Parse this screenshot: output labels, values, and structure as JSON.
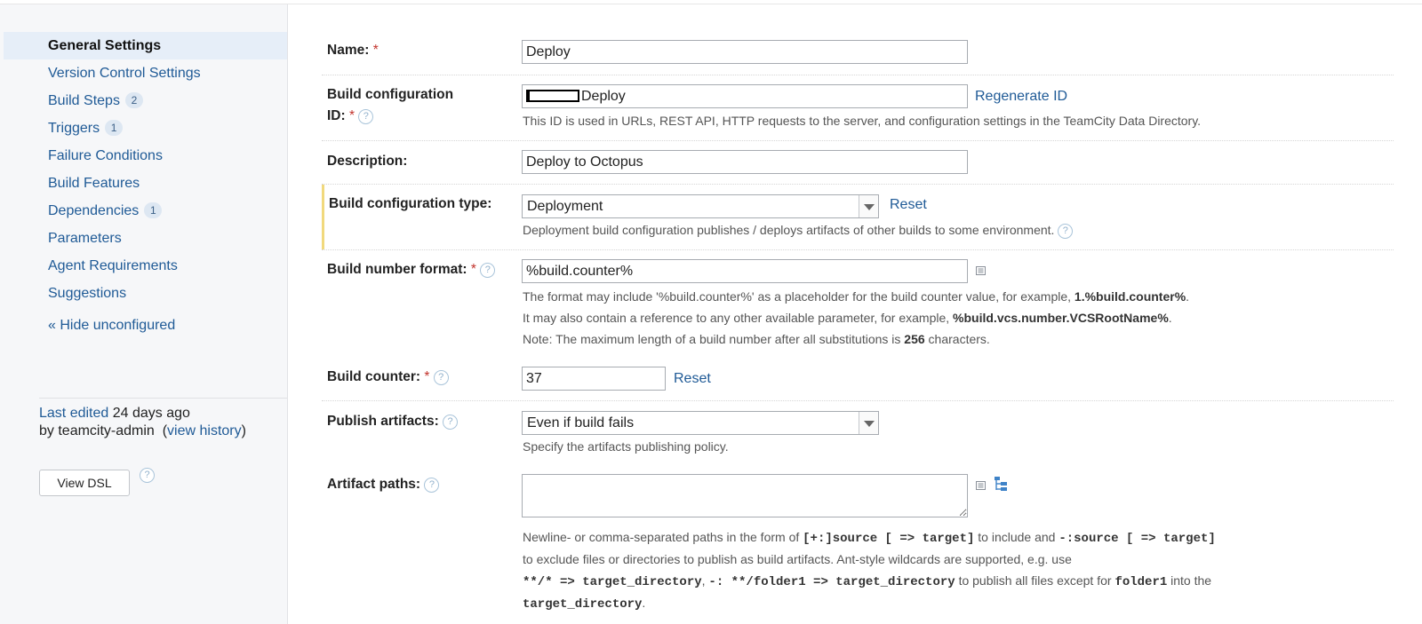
{
  "sidebar": {
    "items": [
      {
        "label": "General Settings"
      },
      {
        "label": "Version Control Settings"
      },
      {
        "label": "Build Steps",
        "badge": "2"
      },
      {
        "label": "Triggers",
        "badge": "1"
      },
      {
        "label": "Failure Conditions"
      },
      {
        "label": "Build Features"
      },
      {
        "label": "Dependencies",
        "badge": "1"
      },
      {
        "label": "Parameters"
      },
      {
        "label": "Agent Requirements"
      },
      {
        "label": "Suggestions"
      }
    ],
    "hide_unconfigured": "« Hide unconfigured",
    "last_edited_prefix": "Last edited",
    "last_edited_time": "24 days ago",
    "edited_by_prefix": "by teamcity-admin",
    "open_paren": "(",
    "view_history": "view history",
    "close_paren": ")",
    "view_dsl": "View DSL"
  },
  "form": {
    "name": {
      "label": "Name:",
      "required": "*",
      "value": "Deploy"
    },
    "build_id": {
      "label_line1": "Build configuration",
      "label_line2": "ID:",
      "required": "*",
      "value": "Deploy",
      "regenerate": "Regenerate ID",
      "note": "This ID is used in URLs, REST API, HTTP requests to the server, and configuration settings in the TeamCity Data Directory."
    },
    "description": {
      "label": "Description:",
      "value": "Deploy to Octopus"
    },
    "config_type": {
      "label": "Build configuration type:",
      "value": "Deployment",
      "reset": "Reset",
      "note": "Deployment build configuration publishes / deploys artifacts of other builds to some environment."
    },
    "build_number": {
      "label": "Build number format:",
      "required": "*",
      "value": "%build.counter%",
      "note1_pre": "The format may include '%build.counter%' as a placeholder for the build counter value, for example,",
      "note1_bold": "1.%build.counter%",
      "note1_post": ".",
      "note2_pre": "It may also contain a reference to any other available parameter, for example,",
      "note2_bold": "%build.vcs.number.VCSRootName%",
      "note2_post": ".",
      "note3_pre": "Note: The maximum length of a build number after all substitutions is",
      "note3_bold": "256",
      "note3_post": "characters."
    },
    "build_counter": {
      "label": "Build counter:",
      "required": "*",
      "value": "37",
      "reset": "Reset"
    },
    "publish_artifacts": {
      "label": "Publish artifacts:",
      "value": "Even if build fails",
      "note": "Specify the artifacts publishing policy."
    },
    "artifact_paths": {
      "label": "Artifact paths:",
      "value": "",
      "l1_a": "Newline- or comma-separated paths in the form of",
      "l1_code1": "[+:]source [ => target]",
      "l1_b": "to include and",
      "l1_code2": "-:source [ => target]",
      "l2": "to exclude files or directories to publish as build artifacts. Ant-style wildcards are supported, e.g. use",
      "l3_code1": "**/* => target_directory",
      "l3_comma": ",",
      "l3_code2": "-: **/folder1 => target_directory",
      "l3_b": "to publish all files except for",
      "l3_code3": "folder1",
      "l3_c": "into the",
      "l4_code": "target_directory",
      "l4_end": "."
    },
    "help_glyph": "?"
  },
  "colors": {
    "link": "#1f5a96",
    "required": "#c2332c",
    "active_bg": "#e6eef8",
    "highlight": "#f1d97d"
  }
}
